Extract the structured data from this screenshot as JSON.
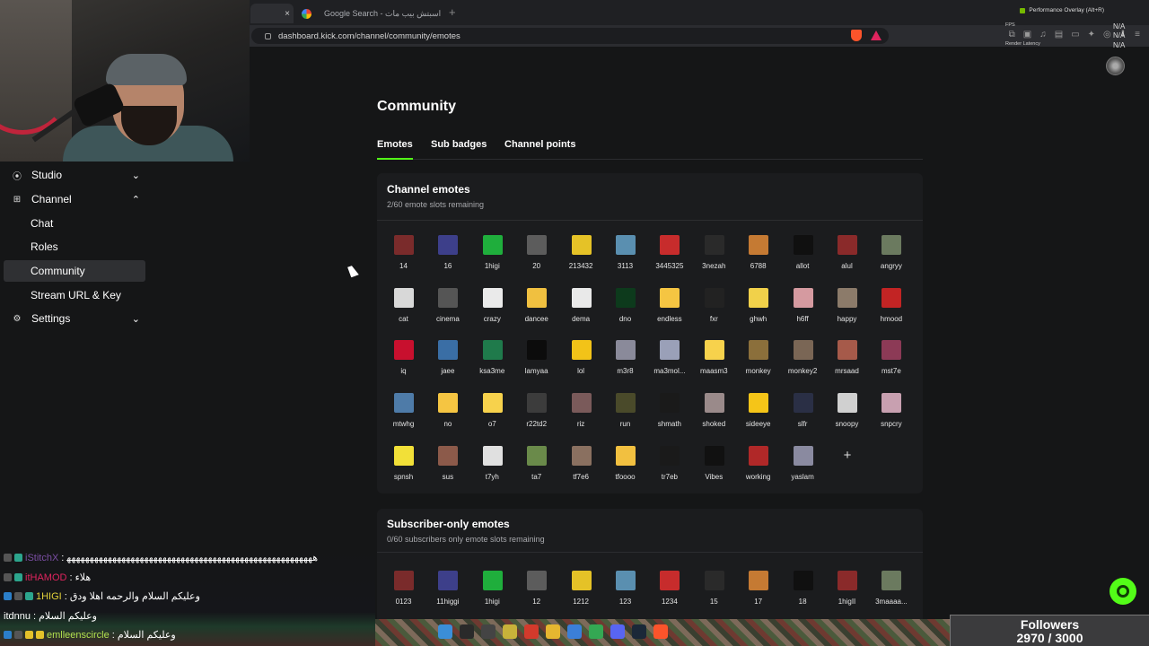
{
  "browser": {
    "tab_active_close": "×",
    "tab2_title": "Google Search - اسبتش بيب مات",
    "new_tab": "+",
    "url": "dashboard.kick.com/channel/community/emotes",
    "perf_overlay": "Performance Overlay (Alt+R)",
    "fps_label": "FPS",
    "render_latency_label": "Render Latency",
    "na1": "N/A",
    "na2": "N/A",
    "na3": "N/A"
  },
  "sidebar": {
    "items": [
      {
        "label": "Studio",
        "icon": "studio-icon",
        "chevron": "down"
      },
      {
        "label": "Channel",
        "icon": "channel-icon",
        "chevron": "up"
      },
      {
        "label": "Chat"
      },
      {
        "label": "Roles"
      },
      {
        "label": "Community",
        "selected": true
      },
      {
        "label": "Stream URL & Key"
      },
      {
        "label": "Settings",
        "icon": "gear-icon",
        "chevron": "down"
      }
    ]
  },
  "page": {
    "title": "Community",
    "tabs": [
      "Emotes",
      "Sub badges",
      "Channel points"
    ],
    "active_tab": "Emotes"
  },
  "channel_emotes": {
    "title": "Channel emotes",
    "subtitle": "2/60 emote slots remaining",
    "emotes": [
      "14",
      "16",
      "1higi",
      "20",
      "213432",
      "3113",
      "3445325",
      "3nezah",
      "6788",
      "allot",
      "alul",
      "angryy",
      "cat",
      "cinema",
      "crazy",
      "dancee",
      "dema",
      "dno",
      "endless",
      "fxr",
      "ghwh",
      "h6ff",
      "happy",
      "hmood",
      "iq",
      "jaee",
      "ksa3me",
      "lamyaa",
      "lol",
      "m3r8",
      "ma3mol...",
      "maasm3",
      "monkey",
      "monkey2",
      "mrsaad",
      "mst7e",
      "mtwhg",
      "no",
      "o7",
      "r22td2",
      "riz",
      "run",
      "shmath",
      "shoked",
      "sideeye",
      "slfr",
      "snoopy",
      "snpcry",
      "spnsh",
      "sus",
      "t7yh",
      "ta7",
      "tf7e6",
      "tfoooo",
      "tr7eb",
      "Vibes",
      "working",
      "yaslam"
    ],
    "add_label": "+"
  },
  "subscriber_emotes": {
    "title": "Subscriber-only emotes",
    "subtitle": "0/60 subscribers only emote slots remaining",
    "emotes": [
      "0123",
      "11higgi",
      "1higi",
      "12",
      "1212",
      "123",
      "1234",
      "15",
      "17",
      "18",
      "1higII",
      "3maaaa..."
    ]
  },
  "chat": {
    "lines": [
      {
        "user": "iStitchX",
        "msg": ": ﻫﻬﻬﻬﻬﻬﻬﻬﻬﻬﻬﻬﻬﻬﻬﻬﻬﻬﻬﻬﻬﻬﻬﻬﻬﻬﻬﻬﻬﻬﻬﻬﻬﻬﻬﻬﻬﻬﻬﻬﻬﻬﻬﻬﻬﻬﻬﻬﻬﻬﻬﻬﻬﻬﻬ",
        "color": "#7a4ea3"
      },
      {
        "user": "itHAMOD",
        "msg": ": هلاء",
        "color": "#e0245e"
      },
      {
        "user": "1HIGI",
        "msg": ": وعليكم السلام والرحمه اهلا ودق",
        "color": "#e3d23a"
      },
      {
        "user": "itdnnu",
        "msg": ": وعليكم السلام",
        "color": "#ffffff"
      },
      {
        "user": "emlleenscircle",
        "msg": ": وعليكم السلام",
        "color": "#b1e04f"
      }
    ]
  },
  "followers": {
    "label": "Followers",
    "value": "2970 / 3000"
  },
  "colors": {
    "accent": "#53fc18",
    "background": "#151617",
    "card": "#1b1c1e"
  }
}
